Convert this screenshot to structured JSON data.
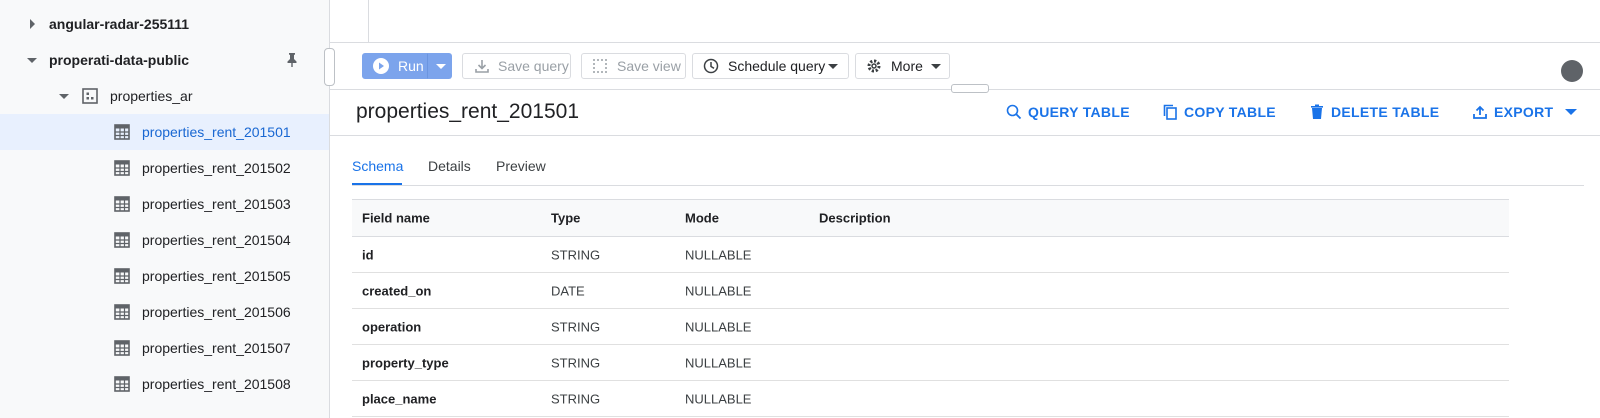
{
  "sidebar": {
    "projects": [
      {
        "name": "angular-radar-255111",
        "expanded": false
      },
      {
        "name": "properati-data-public",
        "expanded": true
      }
    ],
    "dataset": "properties_ar",
    "tables": [
      "properties_rent_201501",
      "properties_rent_201502",
      "properties_rent_201503",
      "properties_rent_201504",
      "properties_rent_201505",
      "properties_rent_201506",
      "properties_rent_201507",
      "properties_rent_201508"
    ],
    "selected_table": "properties_rent_201501"
  },
  "toolbar": {
    "run_label": "Run",
    "save_query_label": "Save query",
    "save_view_label": "Save view",
    "schedule_label": "Schedule query",
    "more_label": "More"
  },
  "header": {
    "title": "properties_rent_201501",
    "actions": {
      "query": "QUERY TABLE",
      "copy": "COPY TABLE",
      "delete": "DELETE TABLE",
      "export": "EXPORT"
    }
  },
  "tabs": [
    "Schema",
    "Details",
    "Preview"
  ],
  "active_tab": "Schema",
  "schema": {
    "columns": [
      "Field name",
      "Type",
      "Mode",
      "Description"
    ],
    "rows": [
      {
        "field": "id",
        "type": "STRING",
        "mode": "NULLABLE",
        "description": ""
      },
      {
        "field": "created_on",
        "type": "DATE",
        "mode": "NULLABLE",
        "description": ""
      },
      {
        "field": "operation",
        "type": "STRING",
        "mode": "NULLABLE",
        "description": ""
      },
      {
        "field": "property_type",
        "type": "STRING",
        "mode": "NULLABLE",
        "description": ""
      },
      {
        "field": "place_name",
        "type": "STRING",
        "mode": "NULLABLE",
        "description": ""
      }
    ]
  },
  "colors": {
    "accent": "#1a73e8",
    "run_button": "#7ca4ec",
    "selected_row": "#e8f0fe"
  }
}
